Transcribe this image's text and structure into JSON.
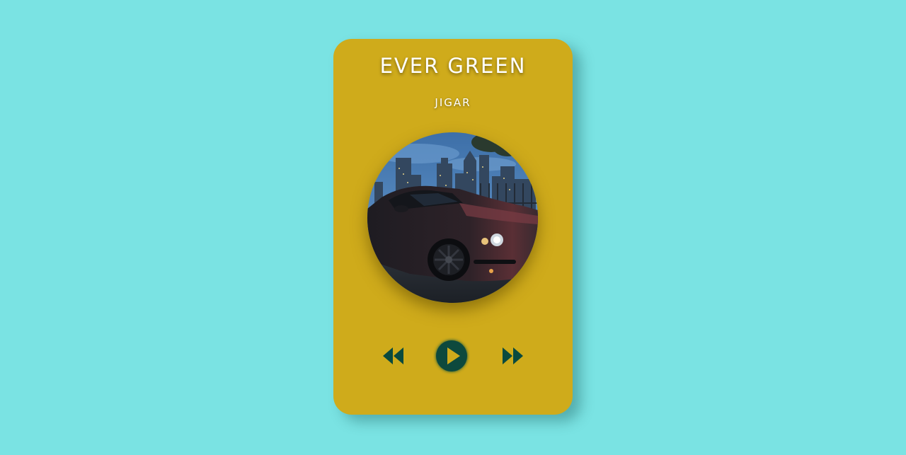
{
  "player": {
    "song_title": "EVER GREEN",
    "artist": "JIGAR",
    "album_art": {
      "icon": "album-art-car-city-night"
    },
    "controls": {
      "rewind_icon": "rewind-icon",
      "play_icon": "play-icon",
      "forward_icon": "fast-forward-icon"
    }
  },
  "colors": {
    "background": "#7ae3e3",
    "card": "#cfab1b",
    "controls": "#0a4a3e",
    "text": "#ffffff"
  }
}
